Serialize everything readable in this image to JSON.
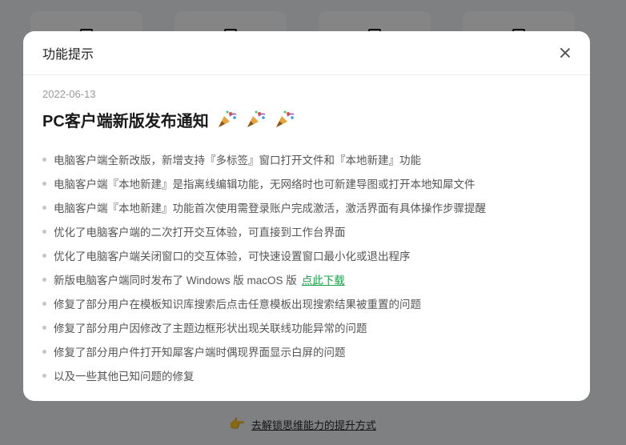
{
  "modal": {
    "title": "功能提示",
    "date": "2022-06-13",
    "headline": "PC客户端新版发布通知",
    "headline_icons": [
      "party-popper-icon",
      "party-popper-icon",
      "party-popper-icon"
    ],
    "notes": [
      "电脑客户端全新改版，新增支持『多标签』窗口打开文件和『本地新建』功能",
      "电脑客户端『本地新建』是指离线编辑功能，无网络时也可新建导图或打开本地知犀文件",
      "电脑客户端『本地新建』功能首次使用需登录账户完成激活，激活界面有具体操作步骤提醒",
      "优化了电脑客户端的二次打开交互体验，可直接到工作台界面",
      "优化了电脑客户端关闭窗口的交互体验，可快速设置窗口最小化或退出程序",
      "新版电脑客户端同时发布了 Windows 版 macOS 版",
      "修复了部分用户在模板知识库搜索后点击任意模板出现搜索结果被重置的问题",
      "修复了部分用户因修改了主题边框形状出现关联线功能异常的问题",
      "修复了部分用户件打开知犀客户端时偶现界面显示白屏的问题",
      "以及一些其他已知问题的修复"
    ],
    "download_link": "点此下载"
  },
  "background": {
    "bottom_link": "去解锁思维能力的提升方式",
    "bottom_icon": "pointing-hand-icon"
  },
  "colors": {
    "link_green": "#1aa34a",
    "overlay": "rgba(0,0,0,0.48)"
  }
}
